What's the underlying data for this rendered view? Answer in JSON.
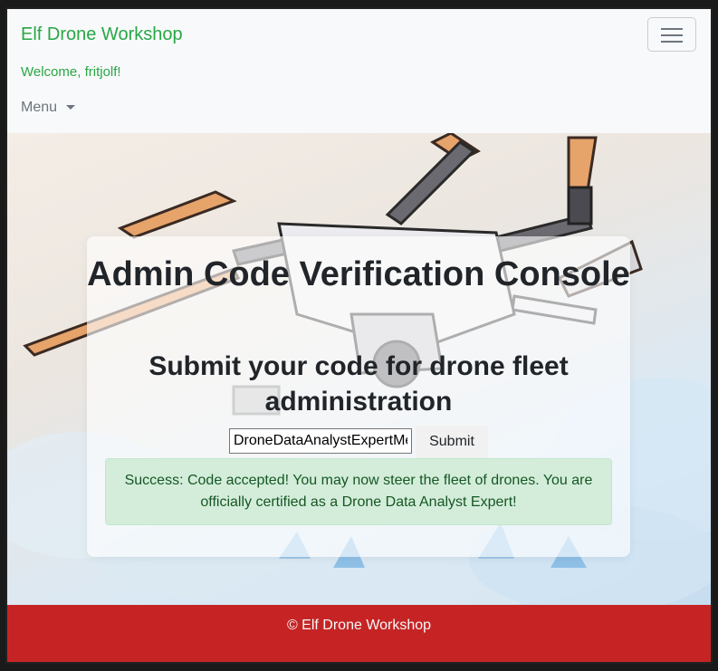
{
  "navbar": {
    "brand": "Elf Drone Workshop",
    "welcome": "Welcome, fritjolf!",
    "menu_label": "Menu",
    "toggler_icon": "hamburger-icon"
  },
  "main": {
    "title": "Admin Code Verification Console",
    "subtitle": "Submit your code for drone fleet administration",
    "code_input_value": "DroneDataAnalystExpertMe",
    "submit_label": "Submit",
    "alert_text": "Success: Code accepted! You may now steer the fleet of drones. You are officially certified as a Drone Data Analyst Expert!"
  },
  "footer": {
    "text": "© Elf Drone Workshop"
  },
  "colors": {
    "brand_green": "#28a745",
    "footer_red": "#c62424",
    "alert_bg": "#d4edda"
  }
}
